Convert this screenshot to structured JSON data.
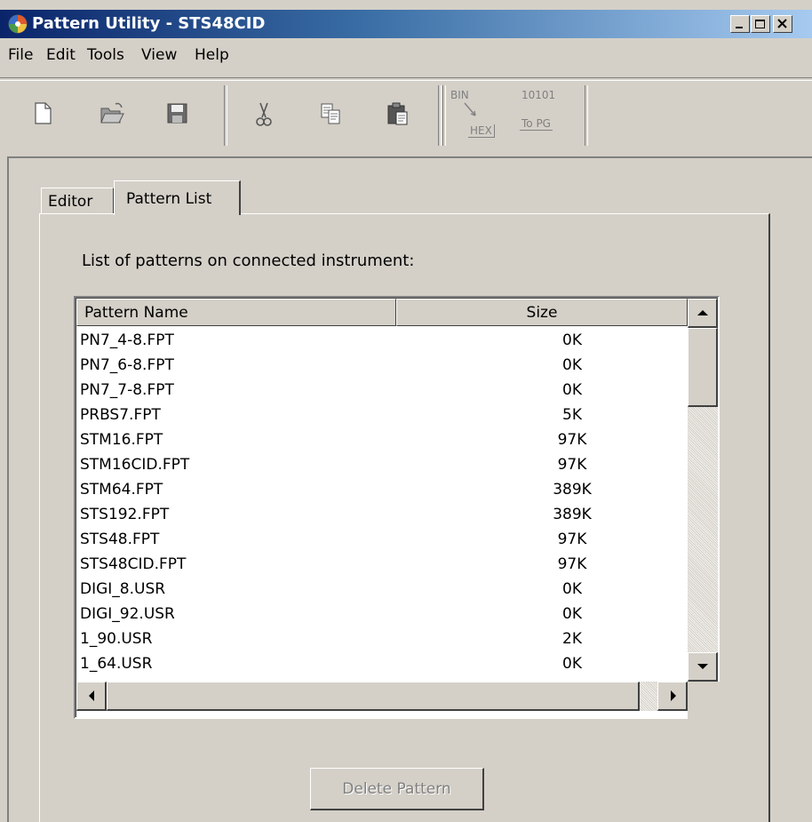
{
  "window": {
    "title": "Pattern Utility - STS48CID"
  },
  "menu": [
    "File",
    "Edit",
    "Tools",
    "View",
    "Help"
  ],
  "toolbar": {
    "icons": [
      "new-icon",
      "open-icon",
      "save-icon",
      "cut-icon",
      "copy-icon",
      "paste-icon"
    ],
    "bin_hex": {
      "top": "BIN",
      "bottom": "HEX"
    },
    "to_pg": {
      "top": "10101",
      "bottom": "To PG"
    }
  },
  "tabs": [
    {
      "label": "Editor",
      "active": false
    },
    {
      "label": "Pattern List",
      "active": true
    }
  ],
  "pattern_list": {
    "label": "List of patterns on connected instrument:",
    "columns": [
      "Pattern Name",
      "Size"
    ],
    "rows": [
      {
        "name": "PN7_4-8.FPT",
        "size": "0K"
      },
      {
        "name": "PN7_6-8.FPT",
        "size": "0K"
      },
      {
        "name": "PN7_7-8.FPT",
        "size": "0K"
      },
      {
        "name": "PRBS7.FPT",
        "size": "5K"
      },
      {
        "name": "STM16.FPT",
        "size": "97K"
      },
      {
        "name": "STM16CID.FPT",
        "size": "97K"
      },
      {
        "name": "STM64.FPT",
        "size": "389K"
      },
      {
        "name": "STS192.FPT",
        "size": "389K"
      },
      {
        "name": "STS48.FPT",
        "size": "97K"
      },
      {
        "name": "STS48CID.FPT",
        "size": "97K"
      },
      {
        "name": "DIGI_8.USR",
        "size": "0K"
      },
      {
        "name": "DIGI_92.USR",
        "size": "0K"
      },
      {
        "name": "1_90.USR",
        "size": "2K"
      },
      {
        "name": "1_64.USR",
        "size": "0K"
      }
    ]
  },
  "buttons": {
    "delete_pattern": "Delete Pattern"
  }
}
